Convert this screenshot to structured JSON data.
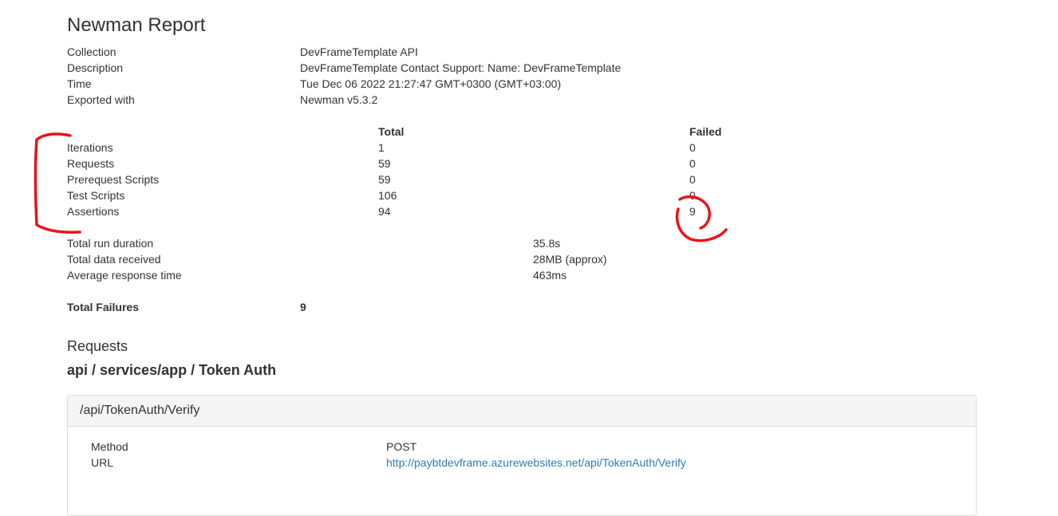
{
  "report": {
    "title": "Newman Report",
    "info": [
      {
        "label": "Collection",
        "value": "DevFrameTemplate API"
      },
      {
        "label": "Description",
        "value": "DevFrameTemplate Contact Support: Name: DevFrameTemplate"
      },
      {
        "label": "Time",
        "value": "Tue Dec 06 2022 21:27:47 GMT+0300 (GMT+03:00)"
      },
      {
        "label": "Exported with",
        "value": "Newman v5.3.2"
      }
    ]
  },
  "summary": {
    "headers": {
      "total": "Total",
      "failed": "Failed"
    },
    "rows": [
      {
        "label": "Iterations",
        "total": "1",
        "failed": "0"
      },
      {
        "label": "Requests",
        "total": "59",
        "failed": "0"
      },
      {
        "label": "Prerequest Scripts",
        "total": "59",
        "failed": "0"
      },
      {
        "label": "Test Scripts",
        "total": "106",
        "failed": "0"
      },
      {
        "label": "Assertions",
        "total": "94",
        "failed": "9"
      }
    ]
  },
  "stats": [
    {
      "label": "Total run duration",
      "value": "35.8s"
    },
    {
      "label": "Total data received",
      "value": "28MB (approx)"
    },
    {
      "label": "Average response time",
      "value": "463ms"
    }
  ],
  "failures": {
    "label": "Total Failures",
    "value": "9"
  },
  "requests": {
    "section_title": "Requests",
    "group_title": "api / services/app / Token Auth",
    "panel": {
      "title": "/api/TokenAuth/Verify",
      "method_label": "Method",
      "method_value": "POST",
      "url_label": "URL",
      "url_value": "http://paybtdevframe.azurewebsites.net/api/TokenAuth/Verify"
    }
  },
  "annotation": {
    "color": "#e8141b"
  }
}
